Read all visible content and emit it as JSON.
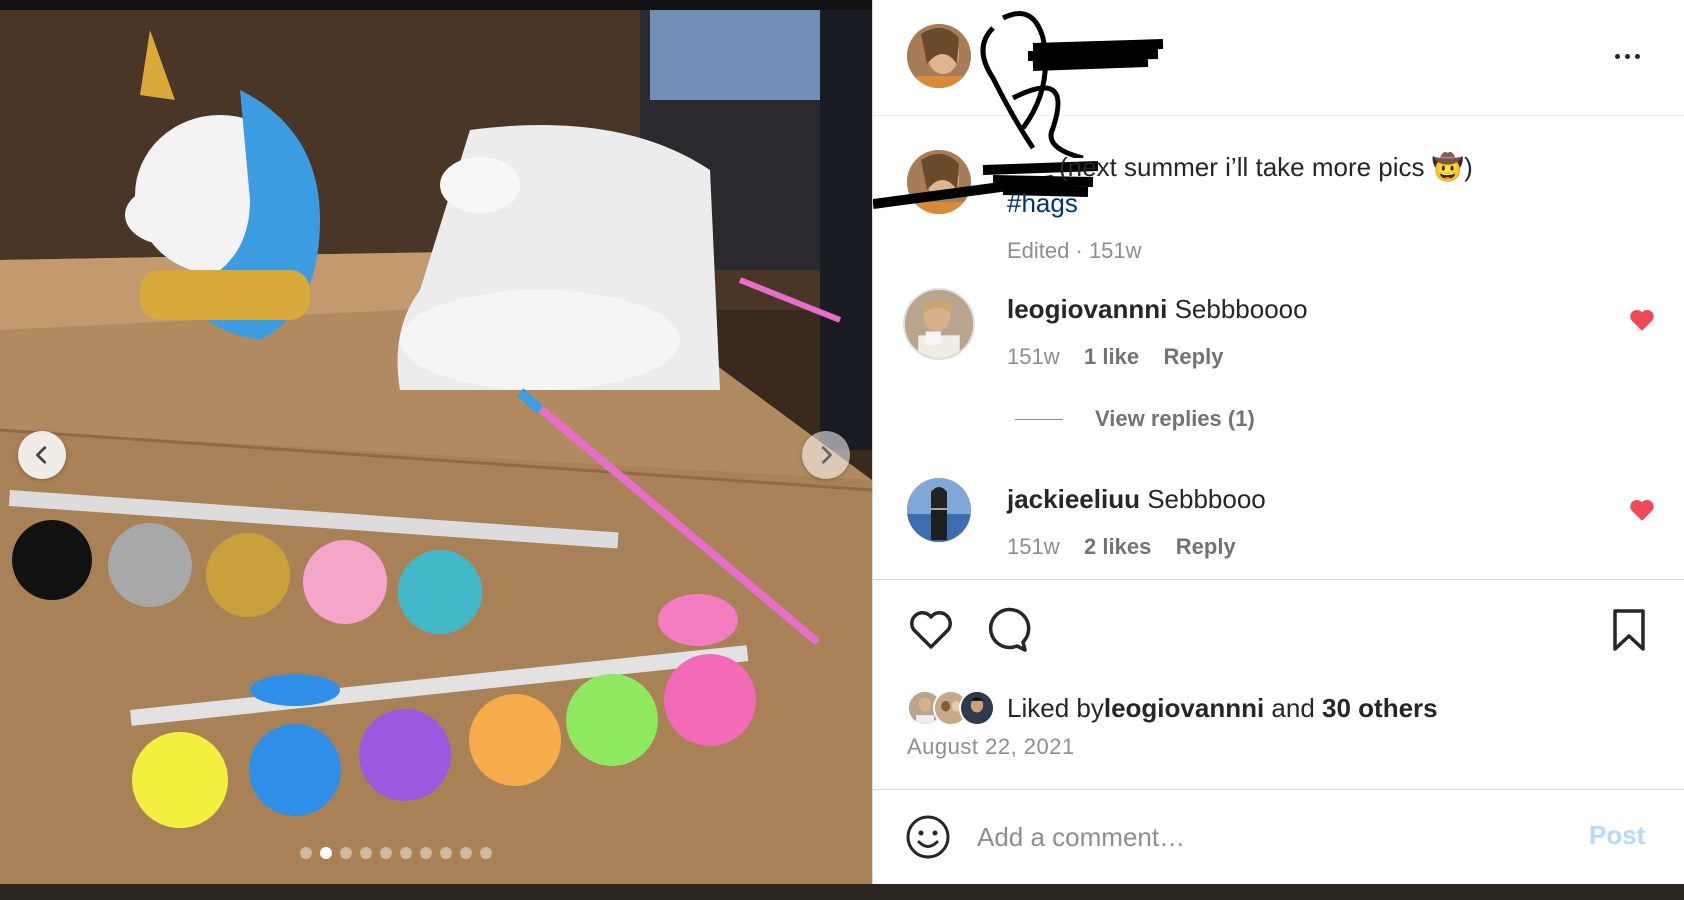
{
  "post": {
    "owner_username": "",
    "photo_alt": "",
    "carousel": {
      "count": 10,
      "active_index": 1
    }
  },
  "caption": {
    "text": "(next summer i’ll take more pics 🤠)",
    "hashtag": "#hags",
    "meta": "Edited · 151w"
  },
  "comments": [
    {
      "username": "leogiovannni",
      "text": "Sebbboooo",
      "time": "151w",
      "likes": "1 like",
      "reply": "Reply",
      "liked": true,
      "view_replies": "View replies (1)"
    },
    {
      "username": "jackieeliuu",
      "text": "Sebbbooo",
      "time": "151w",
      "likes": "2 likes",
      "reply": "Reply",
      "liked": true
    }
  ],
  "engagement": {
    "liked_by_prefix": "Liked by ",
    "liked_by_user": "leogiovannni",
    "liked_by_middle": " and ",
    "liked_by_others": "30 others",
    "date": "August 22, 2021"
  },
  "composer": {
    "placeholder": "Add a comment…",
    "post_label": "Post"
  },
  "icons": {
    "more": "more-options-icon",
    "like": "heart-icon",
    "comment": "comment-icon",
    "save": "bookmark-icon",
    "emoji": "emoji-icon",
    "prev": "chevron-left-icon",
    "next": "chevron-right-icon"
  },
  "colors": {
    "heart_red": "#ed4956",
    "hashtag_blue": "#00376b",
    "post_disabled": "#b3dbff",
    "meta_gray": "#8e8e8e"
  }
}
